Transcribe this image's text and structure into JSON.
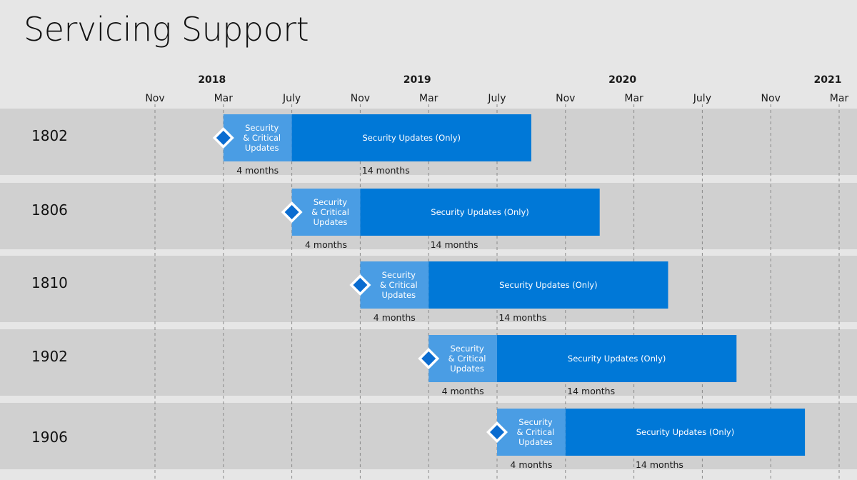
{
  "chart_data": {
    "type": "gantt",
    "title": "Servicing Support",
    "x_axis": {
      "start": "2017-11",
      "end": "2021-03",
      "tick_interval_months": 4,
      "tick_labels": [
        "Nov",
        "Mar",
        "July",
        "Nov",
        "Mar",
        "July",
        "Nov",
        "Mar",
        "July",
        "Nov",
        "Mar"
      ],
      "year_labels": [
        {
          "label": "2018",
          "month": "2018-03"
        },
        {
          "label": "2019",
          "month": "2019-03"
        },
        {
          "label": "2020",
          "month": "2020-03"
        },
        {
          "label": "2021",
          "month": "2021-03"
        }
      ]
    },
    "colors": {
      "phase1": "#4a9de4",
      "phase2": "#0078d7",
      "milestone_fill": "#0a6cd0",
      "milestone_border": "#ffffff"
    },
    "rows": [
      {
        "label": "1802",
        "start": "2018-03",
        "phases": [
          {
            "name": "Security & Critical Updates",
            "lines": [
              "Security",
              "& Critical",
              "Updates"
            ],
            "months": 4,
            "duration_label": "4 months"
          },
          {
            "name": "Security Updates (Only)",
            "lines": [
              "Security Updates (Only)"
            ],
            "months": 14,
            "duration_label": "14 months"
          }
        ]
      },
      {
        "label": "1806",
        "start": "2018-07",
        "phases": [
          {
            "name": "Security & Critical Updates",
            "lines": [
              "Security",
              "& Critical",
              "Updates"
            ],
            "months": 4,
            "duration_label": "4 months"
          },
          {
            "name": "Security Updates (Only)",
            "lines": [
              "Security Updates (Only)"
            ],
            "months": 14,
            "duration_label": "14 months"
          }
        ]
      },
      {
        "label": "1810",
        "start": "2018-11",
        "phases": [
          {
            "name": "Security & Critical Updates",
            "lines": [
              "Security",
              "& Critical",
              "Updates"
            ],
            "months": 4,
            "duration_label": "4 months"
          },
          {
            "name": "Security Updates (Only)",
            "lines": [
              "Security Updates (Only)"
            ],
            "months": 14,
            "duration_label": "14 months"
          }
        ]
      },
      {
        "label": "1902",
        "start": "2019-03",
        "phases": [
          {
            "name": "Security & Critical Updates",
            "lines": [
              "Security",
              "& Critical",
              "Updates"
            ],
            "months": 4,
            "duration_label": "4 months"
          },
          {
            "name": "Security Updates (Only)",
            "lines": [
              "Security Updates (Only)"
            ],
            "months": 14,
            "duration_label": "14 months"
          }
        ]
      },
      {
        "label": "1906",
        "start": "2019-07",
        "phases": [
          {
            "name": "Security & Critical Updates",
            "lines": [
              "Security",
              "& Critical",
              "Updates"
            ],
            "months": 4,
            "duration_label": "4 months"
          },
          {
            "name": "Security Updates (Only)",
            "lines": [
              "Security Updates (Only)"
            ],
            "months": 14,
            "duration_label": "14 months"
          }
        ]
      }
    ]
  }
}
